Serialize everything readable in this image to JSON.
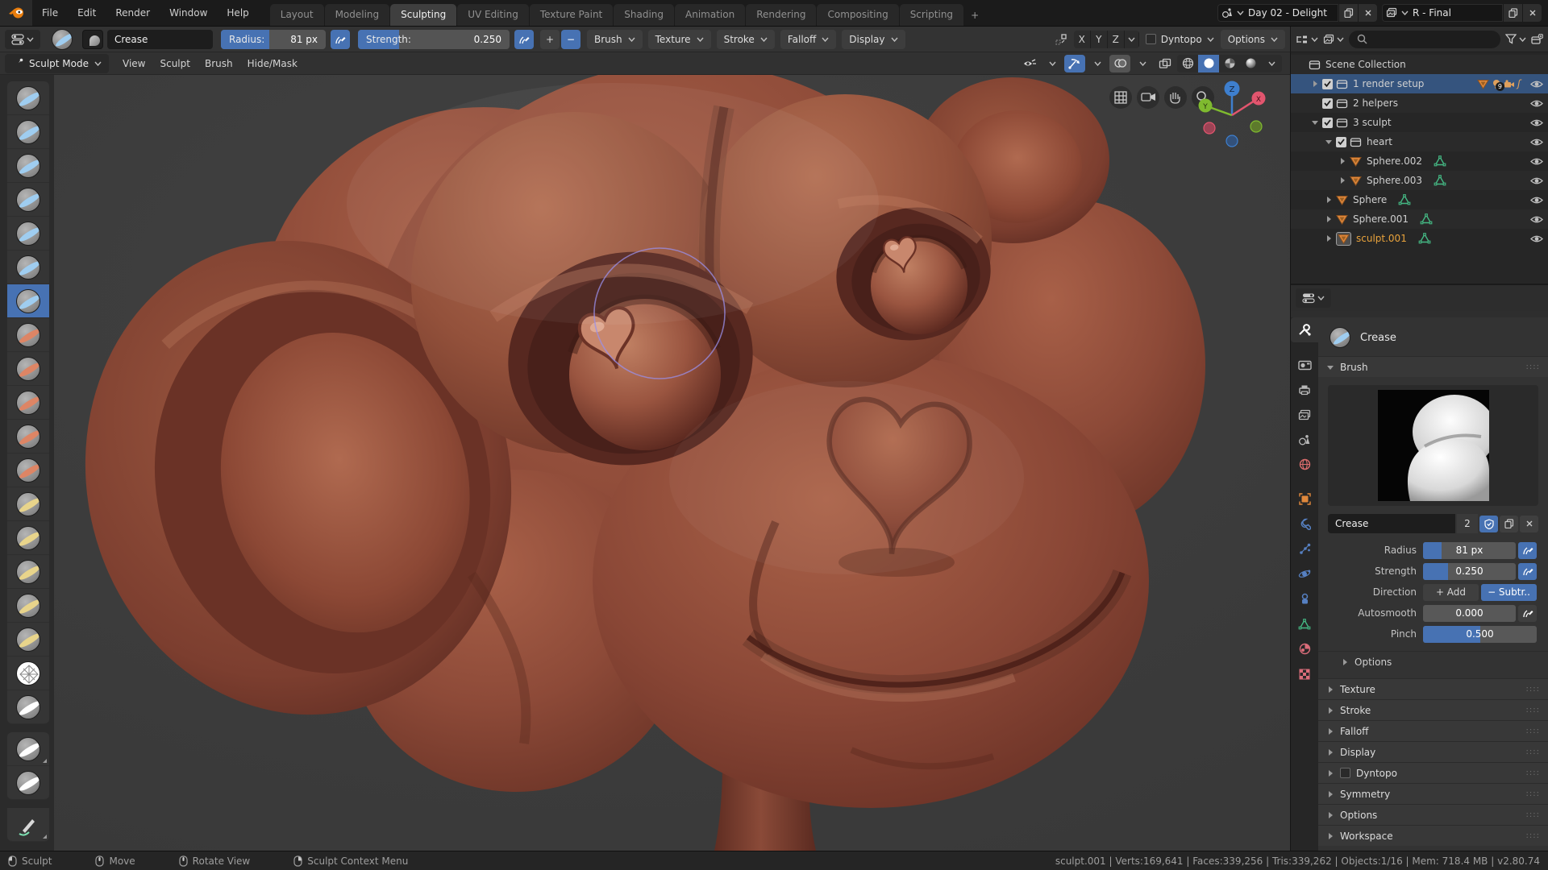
{
  "topbar": {
    "menus": [
      "File",
      "Edit",
      "Render",
      "Window",
      "Help"
    ],
    "workspaces": [
      "Layout",
      "Modeling",
      "Sculpting",
      "UV Editing",
      "Texture Paint",
      "Shading",
      "Animation",
      "Rendering",
      "Compositing",
      "Scripting"
    ],
    "active_workspace": "Sculpting",
    "add_workspace_label": "+",
    "scene": {
      "icon": "scene-icon",
      "value": "Day 02 - Delight",
      "buttons": [
        "copy-icon",
        "close-icon"
      ]
    },
    "view_layer": {
      "icon": "view-layer-icon",
      "value": "R - Final",
      "buttons": [
        "copy-icon",
        "close-icon"
      ]
    }
  },
  "tool_settings": {
    "tool_name": "Crease",
    "radius": {
      "label": "Radius:",
      "value": "81 px",
      "fill": 0.46
    },
    "strength": {
      "label": "Strength:",
      "value": "0.250",
      "fill": 0.27
    },
    "pressure_icon": "pressure-icon",
    "add_label": "+",
    "subtract_label": "−",
    "dropdowns": [
      "Brush",
      "Texture",
      "Stroke",
      "Falloff",
      "Display"
    ],
    "mirror_axes": [
      "X",
      "Y",
      "Z"
    ],
    "dyntopo_label": "Dyntopo",
    "options_label": "Options"
  },
  "outliner_header": {
    "icons": [
      "display-mode-icon",
      "filter-restriction-icon",
      "search-icon",
      "filter-funnel-icon",
      "new-collection-icon"
    ],
    "search_placeholder": ""
  },
  "viewport": {
    "mode_label": "Sculpt Mode",
    "menus": [
      "View",
      "Sculpt",
      "Brush",
      "Hide/Mask"
    ],
    "header_icons": [
      "object-visibility-icon",
      "gizmos-icon",
      "overlays-icon",
      "xray-icon",
      "shading-wireframe-icon",
      "shading-solid-icon",
      "shading-material-icon",
      "shading-rendered-icon"
    ],
    "overlay_buttons": [
      "orthographic-grid-icon",
      "camera-view-icon",
      "pan-hand-icon",
      "zoom-magnifier-icon"
    ],
    "gizmo_axes": [
      "Z",
      "Y",
      "X"
    ],
    "brush_radius_px": 81
  },
  "toolbar": {
    "tools": [
      {
        "name": "draw",
        "accent": "#9fcdf0"
      },
      {
        "name": "clay",
        "accent": "#9fcdf0"
      },
      {
        "name": "clay-strips",
        "accent": "#9fcdf0"
      },
      {
        "name": "layer",
        "accent": "#9fcdf0"
      },
      {
        "name": "inflate",
        "accent": "#9fcdf0"
      },
      {
        "name": "blob",
        "accent": "#9fcdf0"
      },
      {
        "name": "crease",
        "accent": "#9fcdf0",
        "active": true
      },
      {
        "name": "smooth",
        "accent": "#dd8565"
      },
      {
        "name": "flatten",
        "accent": "#dd8565"
      },
      {
        "name": "fill",
        "accent": "#dd8565"
      },
      {
        "name": "scrape",
        "accent": "#dd8565"
      },
      {
        "name": "pinch",
        "accent": "#dd8565"
      },
      {
        "name": "grab",
        "accent": "#e8d48b"
      },
      {
        "name": "snake-hook",
        "accent": "#e8d48b"
      },
      {
        "name": "thumb",
        "accent": "#e8d48b"
      },
      {
        "name": "nudge",
        "accent": "#e8d48b"
      },
      {
        "name": "rotate",
        "accent": "#e8d48b"
      },
      {
        "name": "simplify",
        "accent": "#ffffff"
      },
      {
        "name": "mask",
        "accent": "#ffffff"
      },
      {
        "name": "box-hide",
        "accent": "#ffffff",
        "gap_before": true,
        "submenu": true
      },
      {
        "name": "box-mask",
        "accent": "#ffffff"
      },
      {
        "name": "annotate",
        "accent": "#7de0b2",
        "gap_before": true,
        "submenu": true
      }
    ]
  },
  "outliner": {
    "rows": [
      {
        "label": "Scene Collection",
        "depth": 0,
        "icon": "collection",
        "eye": false
      },
      {
        "label": "1 render setup",
        "depth": 1,
        "arrow": "right",
        "checkbox": true,
        "icon": "collection",
        "selected": true,
        "badges": [
          "mesh",
          "light",
          "camera",
          "sound"
        ],
        "badge_count": "9",
        "eye": true
      },
      {
        "label": "2 helpers",
        "depth": 1,
        "checkbox": true,
        "icon": "collection",
        "eye": true
      },
      {
        "label": "3 sculpt",
        "depth": 1,
        "arrow": "down",
        "checkbox": true,
        "icon": "collection",
        "eye": true
      },
      {
        "label": "heart",
        "depth": 2,
        "arrow": "down",
        "checkbox": true,
        "icon": "collection",
        "eye": true
      },
      {
        "label": "Sphere.002",
        "depth": 3,
        "arrow": "right",
        "icon": "mesh",
        "mesh_data": true,
        "eye": true
      },
      {
        "label": "Sphere.003",
        "depth": 3,
        "arrow": "right",
        "icon": "mesh",
        "mesh_data": true,
        "eye": true
      },
      {
        "label": "Sphere",
        "depth": 2,
        "arrow": "right",
        "icon": "mesh",
        "mesh_data": true,
        "eye": true
      },
      {
        "label": "Sphere.001",
        "depth": 2,
        "arrow": "right",
        "icon": "mesh",
        "mesh_data": true,
        "eye": true
      },
      {
        "label": "sculpt.001",
        "depth": 2,
        "arrow": "right",
        "icon": "mesh",
        "mesh_data": true,
        "active": true,
        "eye": true
      }
    ]
  },
  "properties": {
    "tabs": [
      {
        "name": "tool",
        "color": "#ffffff",
        "active": true,
        "gap": false
      },
      {
        "name": "render",
        "color": "#b8b8b8",
        "gap": true
      },
      {
        "name": "output",
        "color": "#b8b8b8"
      },
      {
        "name": "view-layer",
        "color": "#b8b8b8"
      },
      {
        "name": "scene",
        "color": "#b8b8b8"
      },
      {
        "name": "world",
        "color": "#d96c6c"
      },
      {
        "name": "object",
        "color": "#e0883c",
        "gap": true
      },
      {
        "name": "modifiers",
        "color": "#5680c2"
      },
      {
        "name": "particles",
        "color": "#5680c2"
      },
      {
        "name": "physics",
        "color": "#5680c2"
      },
      {
        "name": "constraints",
        "color": "#5680c2"
      },
      {
        "name": "object-data",
        "color": "#44b984"
      },
      {
        "name": "material",
        "color": "#d96c79"
      },
      {
        "name": "texture",
        "color": "#d96c79"
      }
    ],
    "tool_title": "Crease",
    "brush_panel": {
      "title": "Brush",
      "name_field": {
        "value": "Crease",
        "users": "2",
        "buttons": [
          "shield-icon",
          "copy-icon",
          "close-icon"
        ]
      },
      "rows": [
        {
          "label": "Radius",
          "value": "81 px",
          "fill": 0.2,
          "pressure": true,
          "pressure_on": true
        },
        {
          "label": "Strength",
          "value": "0.250",
          "fill": 0.27,
          "pressure": true,
          "pressure_on": true
        },
        {
          "label": "Direction",
          "type": "buttons",
          "options": [
            {
              "prefix": "+",
              "label": "Add",
              "active": false
            },
            {
              "prefix": "−",
              "label": "Subtr..",
              "active": true
            }
          ]
        },
        {
          "label": "Autosmooth",
          "value": "0.000",
          "fill": 0,
          "pressure": true,
          "pressure_on": false
        },
        {
          "label": "Pinch",
          "value": "0.500",
          "fill": 0.5,
          "pressure": false
        }
      ],
      "subpanel_label": "Options"
    },
    "collapsed_panels": [
      {
        "label": "Texture"
      },
      {
        "label": "Stroke"
      },
      {
        "label": "Falloff"
      },
      {
        "label": "Display"
      },
      {
        "label": "Dyntopo",
        "checkbox": true
      },
      {
        "label": "Symmetry"
      },
      {
        "label": "Options"
      },
      {
        "label": "Workspace"
      }
    ]
  },
  "status_bar": {
    "left_items": [
      {
        "icon": "mouse-left-icon",
        "label": "Sculpt"
      },
      {
        "icon": "mouse-middle-icon",
        "label": "Move"
      },
      {
        "icon": "mouse-middle-icon",
        "label": "Rotate View"
      },
      {
        "icon": "mouse-right-icon",
        "label": "Sculpt Context Menu"
      }
    ],
    "right_text": "sculpt.001 | Verts:169,641 | Faces:339,256 | Tris:339,262 | Objects:1/16 | Mem: 718.4 MB | v2.80.74"
  },
  "colors": {
    "accent_blue": "#4772b3",
    "selected_row": "#35547e",
    "active_object_text": "#e9a33c",
    "mesh_icon_orange": "#e0883c",
    "mesh_data_green": "#44b984",
    "axis_x": "#e2556e",
    "axis_y": "#7fba2f",
    "axis_z": "#3e7fce",
    "clay_base": "#935139"
  }
}
